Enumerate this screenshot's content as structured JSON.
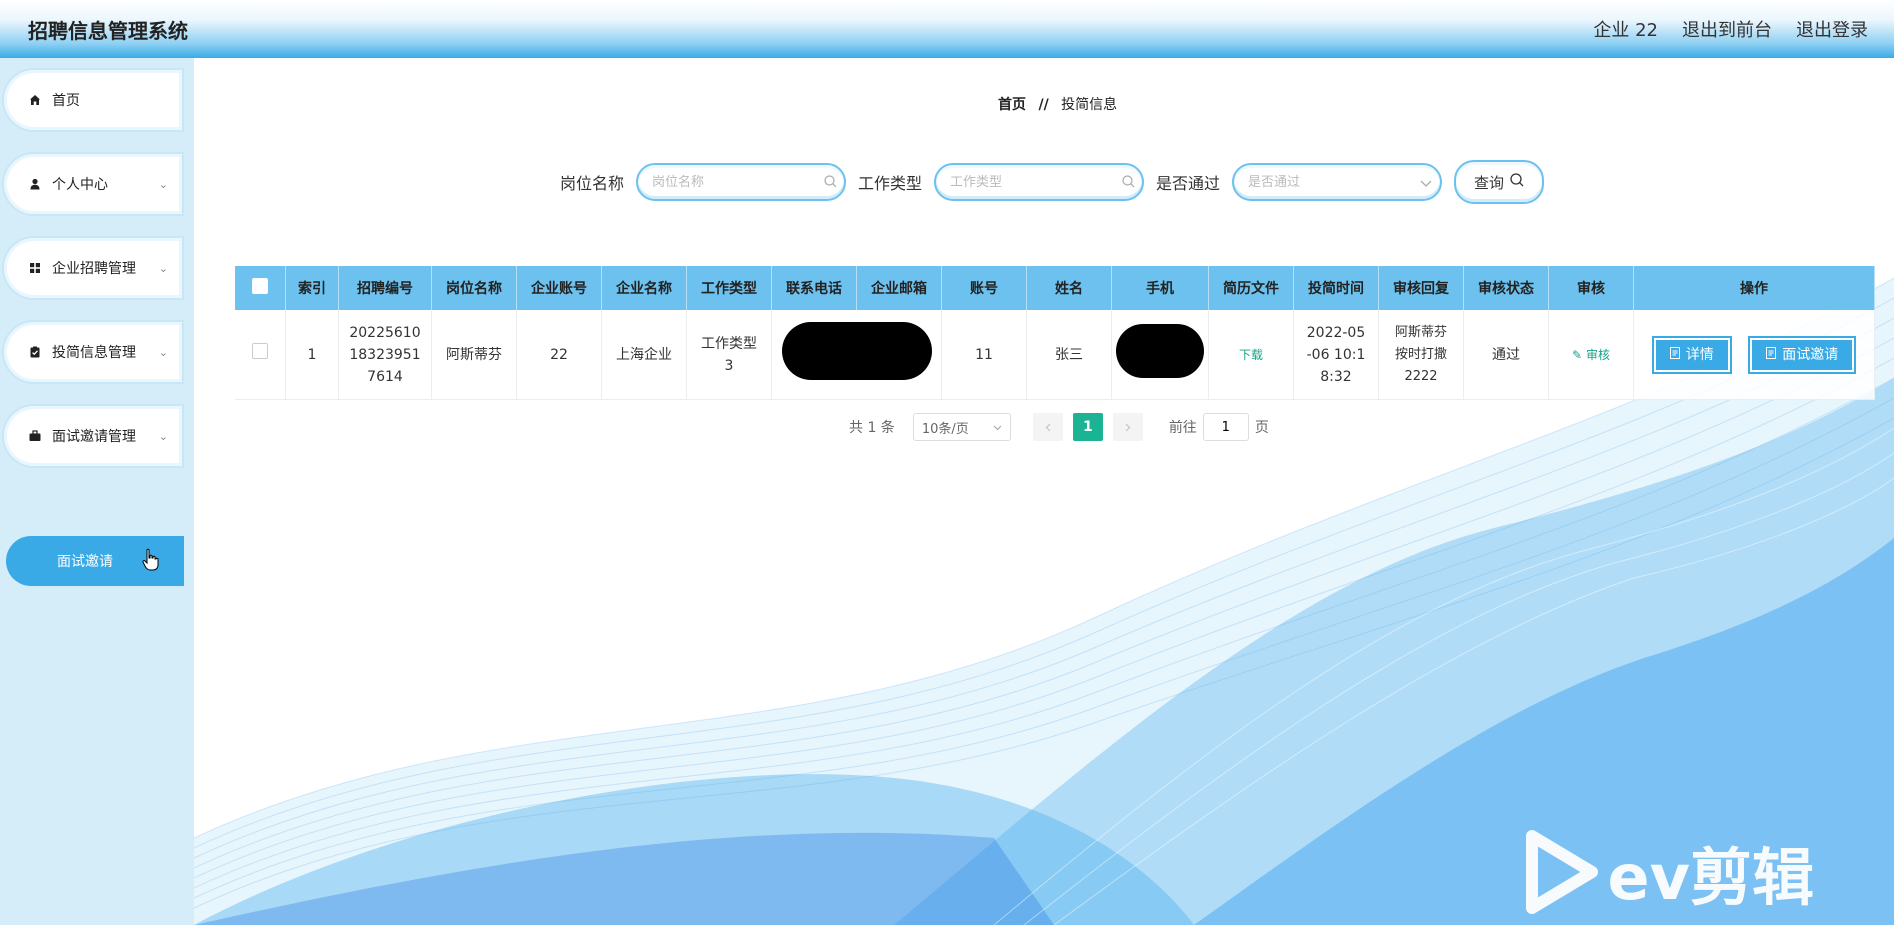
{
  "header": {
    "title": "招聘信息管理系统",
    "user": "企业 22",
    "exit_front": "退出到前台",
    "logout": "退出登录"
  },
  "sidebar": {
    "items": [
      {
        "label": "首页",
        "icon": "home-icon"
      },
      {
        "label": "个人中心",
        "icon": "user-icon"
      },
      {
        "label": "企业招聘管理",
        "icon": "grid-icon"
      },
      {
        "label": "投简信息管理",
        "icon": "clipboard-icon"
      },
      {
        "label": "面试邀请管理",
        "icon": "briefcase-icon"
      }
    ],
    "active_sub": "面试邀请"
  },
  "breadcrumb": {
    "home": "首页",
    "sep": "//",
    "current": "投简信息"
  },
  "search": {
    "position_label": "岗位名称",
    "position_placeholder": "岗位名称",
    "type_label": "工作类型",
    "type_placeholder": "工作类型",
    "passed_label": "是否通过",
    "passed_placeholder": "是否通过",
    "query_label": "查询"
  },
  "table": {
    "headers": [
      "索引",
      "招聘编号",
      "岗位名称",
      "企业账号",
      "企业名称",
      "工作类型",
      "联系电话",
      "企业邮箱",
      "账号",
      "姓名",
      "手机",
      "简历文件",
      "投简时间",
      "审核回复",
      "审核状态",
      "审核",
      "操作"
    ],
    "rows": [
      {
        "index": "1",
        "code": "2022561018323951 7614",
        "code_lines": [
          "20225610",
          "18323951",
          "7614"
        ],
        "position": "阿斯蒂芬",
        "company_account": "22",
        "company_name": "上海企业",
        "job_type_lines": [
          "工作类型",
          "3"
        ],
        "account": "11",
        "name": "张三",
        "resume": "下载",
        "time_lines": [
          "2022-05",
          "-06 10:1",
          "8:32"
        ],
        "reply_lines": [
          "阿斯蒂芬",
          "按时打撒",
          "2222"
        ],
        "status": "通过",
        "audit": "审核",
        "detail_btn": "详情",
        "invite_btn": "面试邀请"
      }
    ]
  },
  "pager": {
    "total": "共 1 条",
    "page_size": "10条/页",
    "current": "1",
    "goto_label": "前往",
    "goto_value": "1",
    "page_suffix": "页"
  },
  "watermark": "ev剪辑",
  "colors": {
    "accent": "#3aaae6",
    "header_bg": "#6cc1ee",
    "page_active": "#1ab394",
    "link": "#18a28a"
  }
}
